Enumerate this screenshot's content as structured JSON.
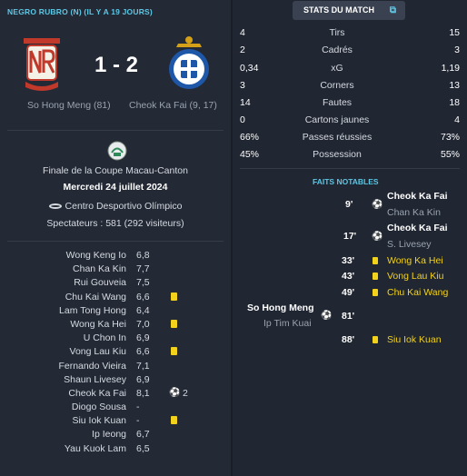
{
  "match": {
    "title": "NEGRO RUBRO (N) (IL Y A 19 JOURS)",
    "score": "1 - 2",
    "home_scorers": "So Hong Meng (81)",
    "away_scorers": "Cheok Ka Fai (9, 17)"
  },
  "info": {
    "competition": "Finale de la Coupe Macau-Canton",
    "date": "Mercredi 24 juillet 2024",
    "stadium": "Centro Desportivo Olímpico",
    "spectators": "Spectateurs : 581 (292 visiteurs)"
  },
  "ratings": [
    {
      "name": "Wong Keng Io",
      "rating": "6,8",
      "icon": ""
    },
    {
      "name": "Chan Ka Kin",
      "rating": "7,7",
      "icon": ""
    },
    {
      "name": "Rui Gouveia",
      "rating": "7,5",
      "icon": ""
    },
    {
      "name": "Chu Kai Wang",
      "rating": "6,6",
      "icon": "yellow-card"
    },
    {
      "name": "Lam Tong Hong",
      "rating": "6,4",
      "icon": ""
    },
    {
      "name": "Wong Ka Hei",
      "rating": "7,0",
      "icon": "yellow-card"
    },
    {
      "name": "U Chon In",
      "rating": "6,9",
      "icon": ""
    },
    {
      "name": "Vong Lau Kiu",
      "rating": "6,6",
      "icon": "yellow-card"
    },
    {
      "name": "Fernando Vieira",
      "rating": "7,1",
      "icon": ""
    },
    {
      "name": "Shaun Livesey",
      "rating": "6,9",
      "icon": ""
    },
    {
      "name": "Cheok Ka Fai",
      "rating": "8,1",
      "icon": "goal",
      "goals": "2"
    },
    {
      "name": "Diogo Sousa",
      "rating": "-",
      "icon": ""
    },
    {
      "name": "Siu Iok Kuan",
      "rating": "-",
      "icon": "yellow-card"
    },
    {
      "name": "Ip Ieong",
      "rating": "6,7",
      "icon": ""
    },
    {
      "name": "Yau Kuok Lam",
      "rating": "6,5",
      "icon": ""
    }
  ],
  "stats_button": {
    "label": "STATS DU MATCH",
    "icon": "external-link-icon"
  },
  "stats": [
    {
      "left": "4",
      "label": "Tirs",
      "right": "15"
    },
    {
      "left": "2",
      "label": "Cadrés",
      "right": "3"
    },
    {
      "left": "0,34",
      "label": "xG",
      "right": "1,19"
    },
    {
      "left": "3",
      "label": "Corners",
      "right": "13"
    },
    {
      "left": "14",
      "label": "Fautes",
      "right": "18"
    },
    {
      "left": "0",
      "label": "Cartons jaunes",
      "right": "4"
    },
    {
      "left": "66%",
      "label": "Passes réussies",
      "right": "73%"
    },
    {
      "left": "45%",
      "label": "Possession",
      "right": "55%"
    }
  ],
  "notable": {
    "title": "FAITS NOTABLES",
    "events": [
      {
        "minute": "9'",
        "player": "Cheok Ka Fai",
        "assist": "Chan Ka Kin"
      },
      {
        "minute": "17'",
        "player": "Cheok Ka Fai",
        "assist": "S. Livesey"
      },
      {
        "minute": "33'",
        "player": "Wong Ka Hei"
      },
      {
        "minute": "43'",
        "player": "Vong Lau Kiu"
      },
      {
        "minute": "49'",
        "player": "Chu Kai Wang"
      },
      {
        "minute": "81'",
        "player": "So Hong Meng",
        "assist": "Ip Tim Kuai"
      },
      {
        "minute": "88'",
        "player": "Siu Iok Kuan"
      }
    ]
  },
  "colors": {
    "accent": "#5bc8e6",
    "card": "#f2d21a",
    "home_badge": "#c0392b",
    "away_badge": "#1f57a8"
  }
}
